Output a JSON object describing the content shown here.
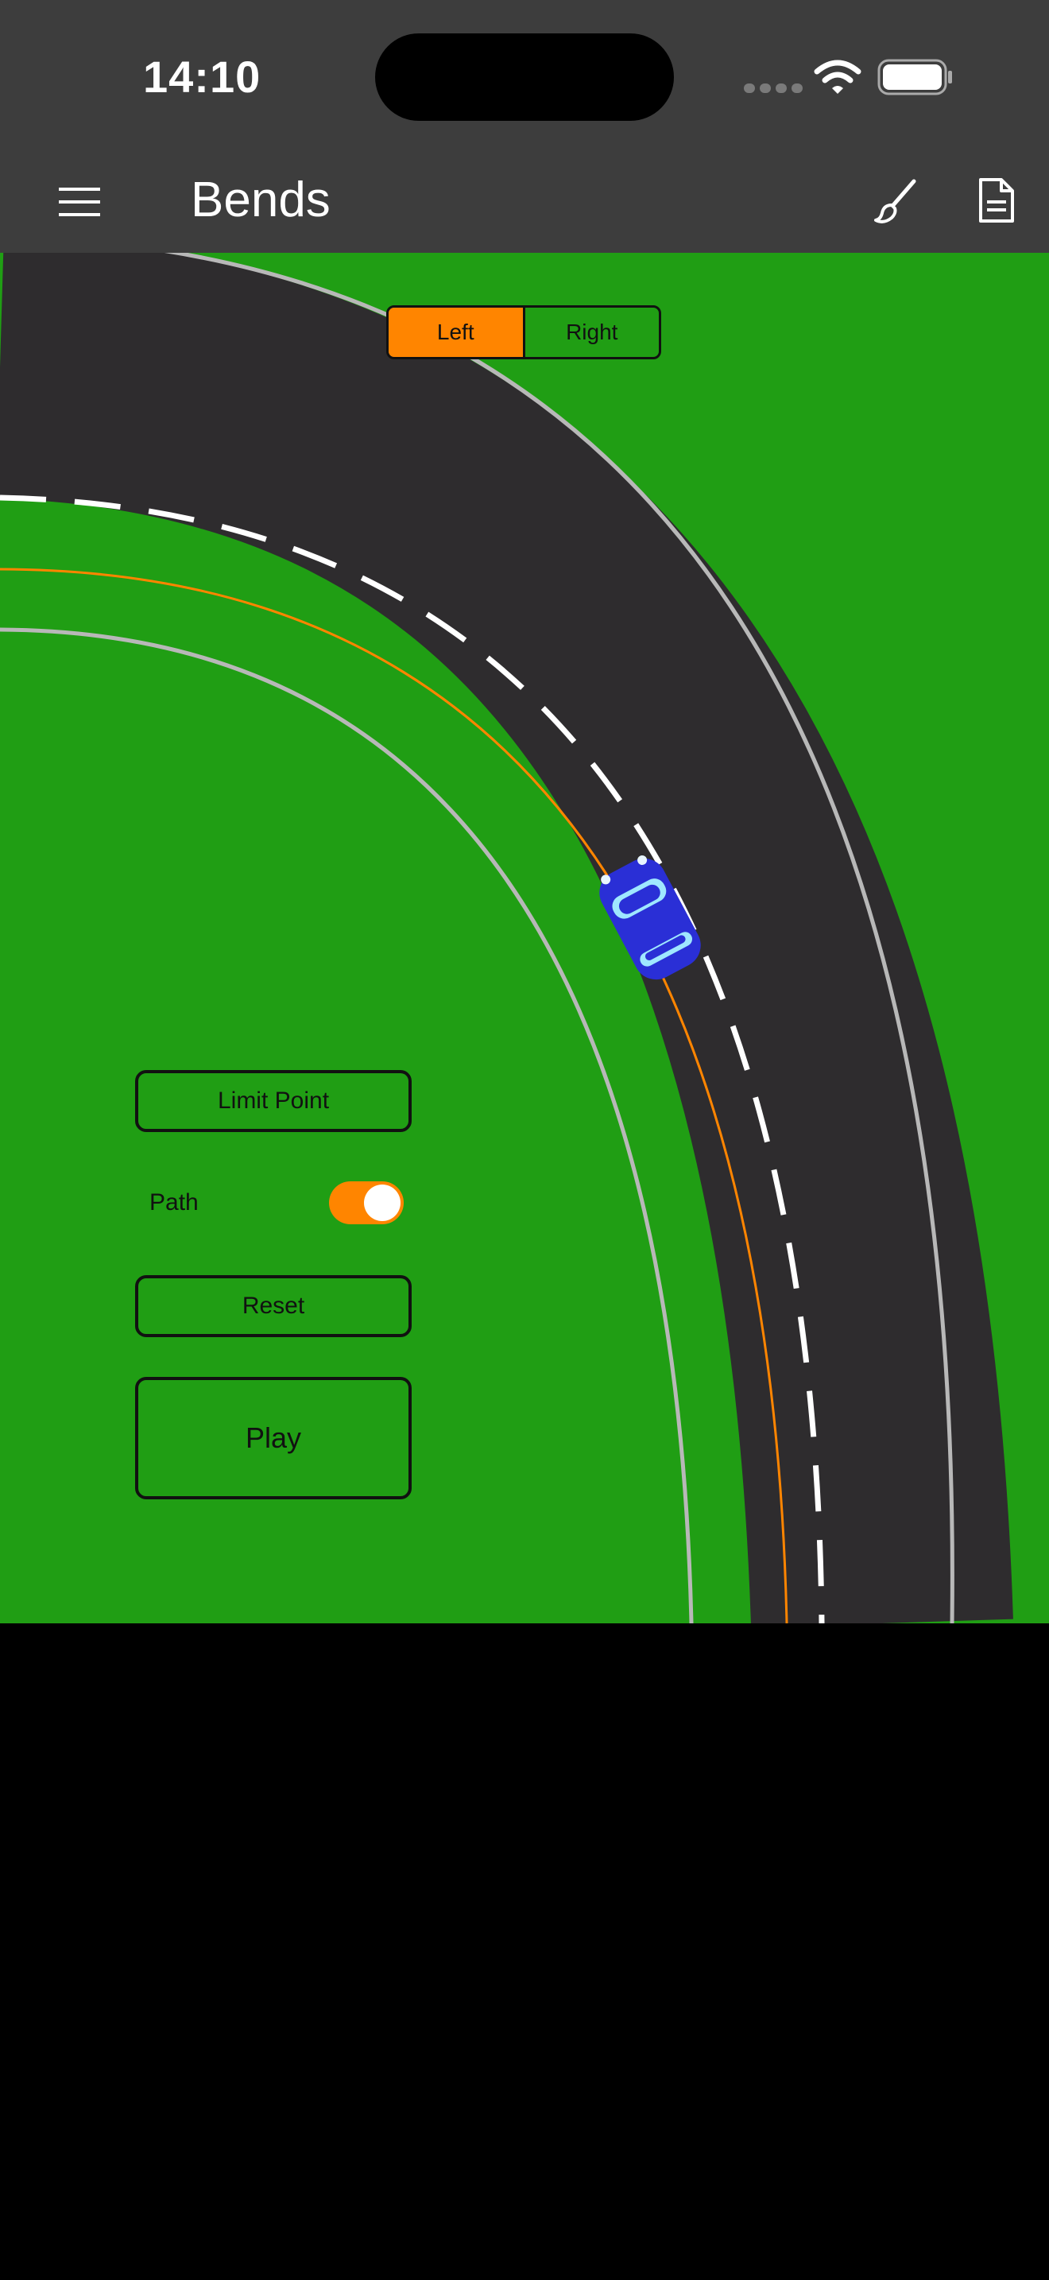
{
  "status_bar": {
    "time": "14:10"
  },
  "nav": {
    "title": "Bends",
    "icons": [
      "menu-icon",
      "brush-icon",
      "document-icon"
    ]
  },
  "direction_control": {
    "options": [
      "Left",
      "Right"
    ],
    "selected": "Left"
  },
  "controls": {
    "limit_point_label": "Limit Point",
    "path_label": "Path",
    "path_enabled": true,
    "reset_label": "Reset",
    "play_label": "Play"
  },
  "colors": {
    "grass": "#209e14",
    "road": "#2e2c2e",
    "accent": "#ff8500",
    "car": "#2a2fd6",
    "bar": "#3d3d3d"
  }
}
